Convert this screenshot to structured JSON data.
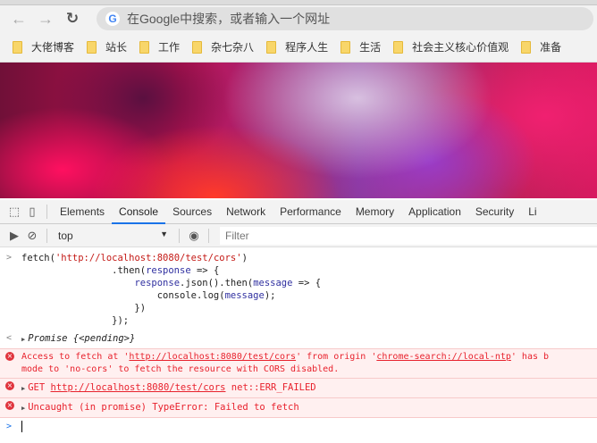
{
  "browser": {
    "omnibox_placeholder": "在Google中搜索，或者输入一个网址",
    "google_letter": "G",
    "bookmarks": [
      "大佬博客",
      "站长",
      "工作",
      "杂七杂八",
      "程序人生",
      "生活",
      "社会主义核心价值观",
      "准备"
    ]
  },
  "devtools": {
    "tabs": [
      "Elements",
      "Console",
      "Sources",
      "Network",
      "Performance",
      "Memory",
      "Application",
      "Security",
      "Li"
    ],
    "active_tab": "Console",
    "context": "top",
    "filter_placeholder": "Filter"
  },
  "console": {
    "input_lines": {
      "l1a": "fetch(",
      "l1b": "'http://localhost:8080/test/cors'",
      "l1c": ")",
      "l2a": "                .then(",
      "l2b": "response",
      "l2c": " => {",
      "l3a": "                    ",
      "l3b": "response",
      "l3c": ".json().then(",
      "l3d": "message",
      "l3e": " => {",
      "l4a": "                        console.log(",
      "l4b": "message",
      "l4c": ");",
      "l5": "                    })",
      "l6": "                });"
    },
    "result": "Promise {<pending>}",
    "errors": {
      "e1_a": "Access to fetch at '",
      "e1_url": "http://localhost:8080/test/cors",
      "e1_b": "' from origin '",
      "e1_origin": "chrome-search://local-ntp",
      "e1_c": "' has b",
      "e1_line2": "mode to 'no-cors' to fetch the resource with CORS disabled.",
      "e2_a": "GET ",
      "e2_url": "http://localhost:8080/test/cors",
      "e2_b": " net::ERR_FAILED",
      "e3": "Uncaught (in promise) TypeError: Failed to fetch"
    }
  }
}
